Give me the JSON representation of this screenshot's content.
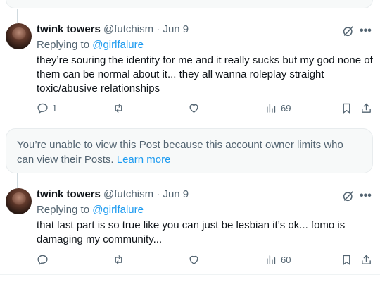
{
  "posts": [
    {
      "display_name": "twink towers",
      "handle": "@futchism",
      "separator": "·",
      "date": "Jun 9",
      "reply_prefix": "Replying to",
      "reply_handle": "@girlfalure",
      "text": "they’re souring the identity for me and it really sucks but my god none of them can be normal about it... they all wanna roleplay straight toxic/abusive relationships",
      "reply_count": "1",
      "repost_count": "",
      "like_count": "",
      "view_count": "69"
    },
    {
      "display_name": "twink towers",
      "handle": "@futchism",
      "separator": "·",
      "date": "Jun 9",
      "reply_prefix": "Replying to",
      "reply_handle": "@girlfalure",
      "text": "that last part is so true like you can just be lesbian it’s ok... fomo is damaging my community...",
      "reply_count": "",
      "repost_count": "",
      "like_count": "",
      "view_count": "60"
    }
  ],
  "notice": {
    "message": "You’re unable to view this Post because this account owner limits who can view their Posts.",
    "link": "Learn more"
  },
  "icons": {
    "more": "more-icon",
    "grok": "grok-icon",
    "reply": "reply-icon",
    "repost": "repost-icon",
    "like": "like-icon",
    "views": "views-icon",
    "bookmark": "bookmark-icon",
    "share": "share-icon"
  },
  "colors": {
    "accent": "#1d9bf0",
    "secondary_text": "#536471",
    "primary_text": "#0f1419",
    "card_bg": "#f7f9f9"
  }
}
